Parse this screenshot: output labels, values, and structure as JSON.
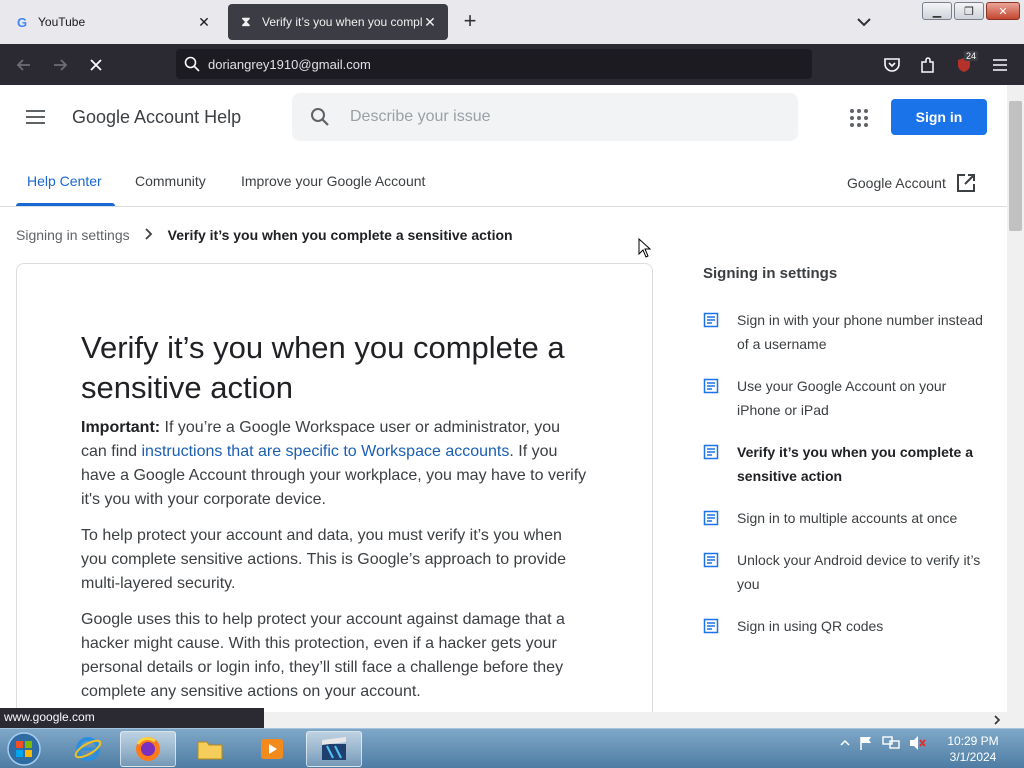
{
  "browser": {
    "tabs": [
      {
        "label": "YouTube",
        "favicon": "google-g-icon"
      },
      {
        "label": "Verify it’s you when you comple",
        "favicon": "hourglass-icon"
      }
    ],
    "url_text": "doriangrey1910@gmail.com",
    "extension_badge": "24",
    "status_text": "www.google.com"
  },
  "header": {
    "product_name": "Google Account Help",
    "search_placeholder": "Describe your issue",
    "sign_in_label": "Sign in",
    "brand_color": "#1a73e8"
  },
  "subnav": {
    "tabs": [
      "Help Center",
      "Community",
      "Improve your Google Account"
    ],
    "active": "Help Center",
    "account_link": "Google Account"
  },
  "breadcrumb": {
    "parent": "Signing in settings",
    "current": "Verify it’s you when you complete a sensitive action"
  },
  "article": {
    "title": "Verify it’s you when you complete a sensitive action",
    "p1_bold": "Important:",
    "p1_a": " If you’re a Google Workspace user or administrator, you can find ",
    "p1_link": "instructions that are specific to Workspace accounts",
    "p1_b": ". If you have a Google Account through your workplace, you may have to verify it's you with your corporate device.",
    "p2": "To help protect your account and data, you must verify it’s you when you complete sensitive actions. This is Google’s approach to provide multi-layered security.",
    "p3": "Google uses this to help protect your account against damage that a hacker might cause. With this protection, even if a hacker gets your personal details or login info, they’ll still face a challenge before they complete any sensitive actions on your account."
  },
  "sidebar": {
    "heading": "Signing in settings",
    "items": [
      "Sign in with your phone number instead of a username",
      "Use your Google Account on your iPhone or iPad",
      "Verify it’s you when you complete a sensitive action",
      "Sign in to multiple accounts at once",
      "Unlock your Android device to verify it’s you",
      "Sign in using QR codes"
    ],
    "current_index": 2
  },
  "taskbar": {
    "time": "10:29 PM",
    "date": "3/1/2024"
  }
}
